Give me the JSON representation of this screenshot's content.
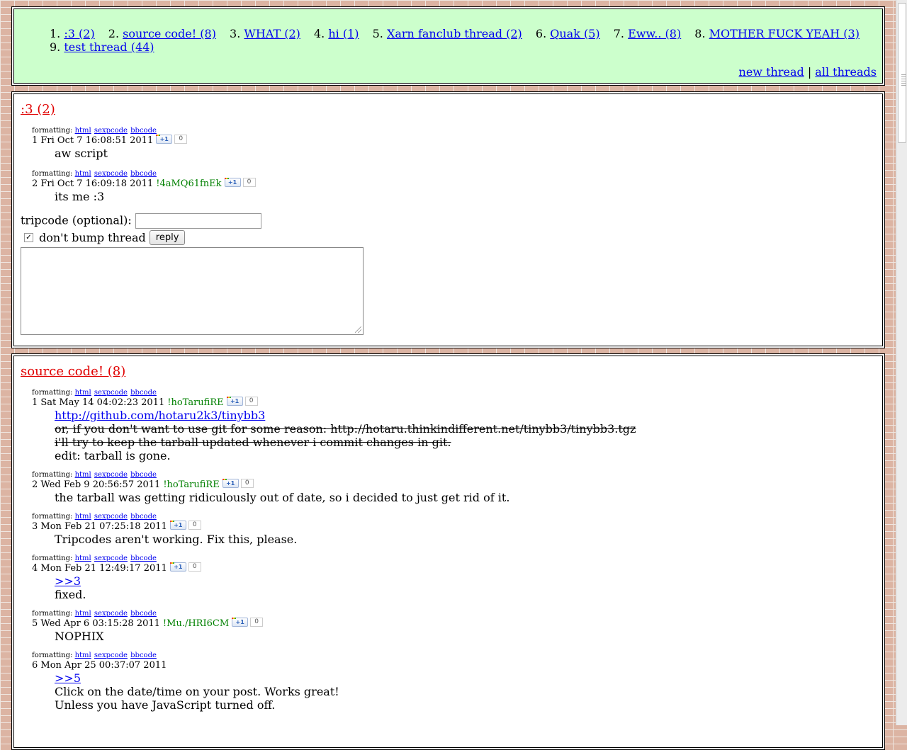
{
  "nav": {
    "threads": [
      {
        "num": "1.",
        "label": ":3 (2)"
      },
      {
        "num": "2.",
        "label": "source code! (8)"
      },
      {
        "num": "3.",
        "label": "WHAT (2)"
      },
      {
        "num": "4.",
        "label": "hi (1)"
      },
      {
        "num": "5.",
        "label": "Xarn fanclub thread (2)"
      },
      {
        "num": "6.",
        "label": "Quak (5)"
      },
      {
        "num": "7.",
        "label": "Eww.. (8)"
      },
      {
        "num": "8.",
        "label": "MOTHER FUCK YEAH (3)"
      },
      {
        "num": "9.",
        "label": "test thread (44)"
      }
    ],
    "new_thread": "new thread",
    "separator": "|",
    "all_threads": "all threads"
  },
  "format_links": {
    "label": "formatting:",
    "html": "html",
    "sexpcode": "sexpcode",
    "bbcode": "bbcode"
  },
  "plusone": {
    "label": "+1",
    "count": "0"
  },
  "thread1": {
    "title": ":3 (2)",
    "posts": [
      {
        "header": "1 Fri Oct 7 16:08:51 2011",
        "trip": "",
        "lines": [
          "aw script"
        ]
      },
      {
        "header": "2 Fri Oct 7 16:09:18 2011",
        "trip": "!4aMQ61fnEk",
        "lines": [
          "its me :3"
        ]
      }
    ],
    "form": {
      "tripcode_label": "tripcode (optional):",
      "tripcode_value": "",
      "dont_bump_label": "don't bump thread",
      "dont_bump_checked": "✓",
      "reply_button": "reply"
    }
  },
  "thread2": {
    "title": "source code! (8)",
    "p1": {
      "header": "1 Sat May 14 04:02:23 2011",
      "trip": "!hoTarufiRE",
      "link": "http://github.com/hotaru2k3/tinybb3",
      "strike1": "or, if you don't want to use git for some reason: http://hotaru.thinkindifferent.net/tinybb3/tinybb3.tgz",
      "strike2": "i'll try to keep the tarball updated whenever i commit changes in git.",
      "text": "edit: tarball is gone."
    },
    "p2": {
      "header": "2 Wed Feb 9 20:56:57 2011",
      "trip": "!hoTarufiRE",
      "text": "the tarball was getting ridiculously out of date, so i decided to just get rid of it."
    },
    "p3": {
      "header": "3 Mon Feb 21 07:25:18 2011",
      "trip": "",
      "text": "Tripcodes aren't working. Fix this, please."
    },
    "p4": {
      "header": "4 Mon Feb 21 12:49:17 2011",
      "trip": "",
      "quote": ">>3",
      "text": "fixed."
    },
    "p5": {
      "header": "5 Wed Apr 6 03:15:28 2011",
      "trip": "!Mu./HRI6CM",
      "text": "NOPHIX"
    },
    "p6": {
      "header": "6 Mon Apr 25 00:37:07 2011",
      "trip": "",
      "quote": ">>5",
      "text": "Click on the date/time on your post. Works great!",
      "text2": "Unless you have JavaScript turned off."
    }
  }
}
